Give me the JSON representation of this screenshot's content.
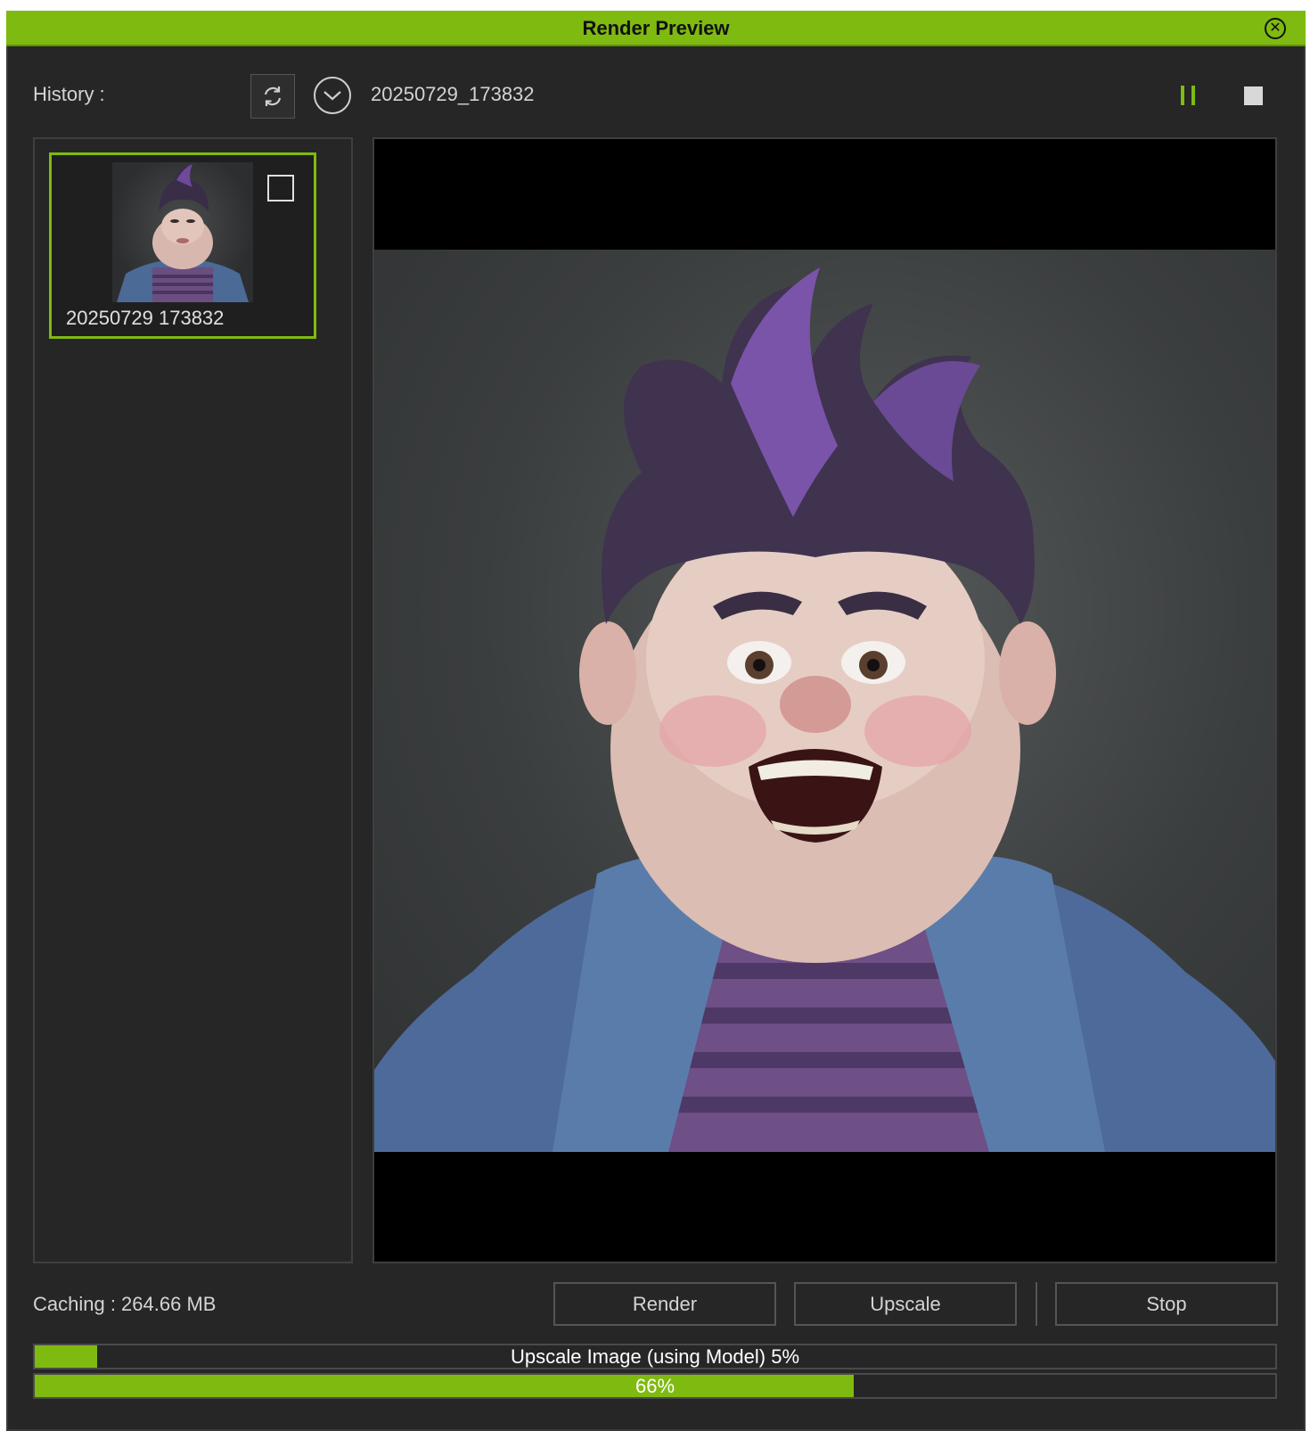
{
  "window": {
    "title": "Render Preview"
  },
  "toolbar": {
    "history_label": "History :",
    "current_item": "20250729_173832"
  },
  "icons": {
    "close": "close-circle-icon",
    "refresh": "refresh-icon",
    "dropdown": "chevron-down-circle-icon",
    "pause": "pause-icon",
    "stop": "stop-icon"
  },
  "history": {
    "items": [
      {
        "label": "20250729  173832",
        "selected": true,
        "checked": false
      }
    ]
  },
  "footer": {
    "caching": "Caching : 264.66 MB",
    "render_label": "Render",
    "upscale_label": "Upscale",
    "stop_label": "Stop"
  },
  "progress": [
    {
      "text": "Upscale Image (using Model) 5%",
      "fraction": 0.05
    },
    {
      "text": "66%",
      "fraction": 0.66
    }
  ],
  "colors": {
    "accent": "#7fba10",
    "background": "#262626",
    "text": "#d4d4d4"
  }
}
